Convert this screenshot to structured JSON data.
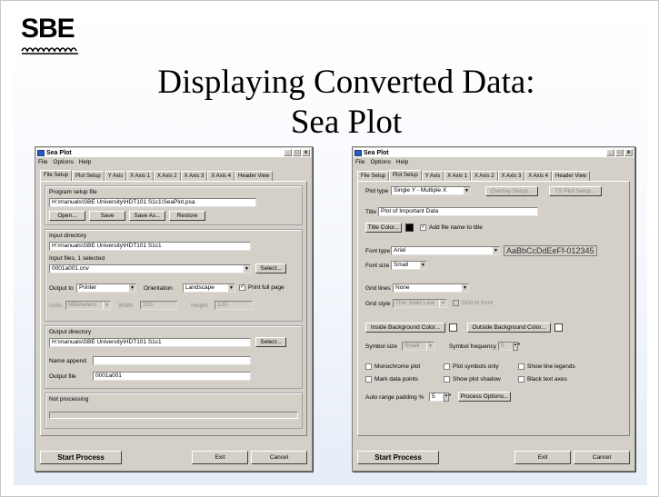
{
  "slide": {
    "logo_text": "SBE",
    "title_line1": "Displaying Converted Data:",
    "title_line2": "Sea Plot"
  },
  "colors": {
    "title_bar": "#ffffff",
    "window_face": "#d4d0c8",
    "app_icon": "#2a5bb8"
  },
  "left_window": {
    "title": "Sea Plot",
    "controls": [
      "_",
      "□",
      "x"
    ],
    "menu": [
      "File",
      "Options",
      "Help"
    ],
    "tabs": [
      "File Setup",
      "Plot Setup",
      "Y Axis",
      "X Axis 1",
      "X Axis 2",
      "X Axis 3",
      "X Axis 4",
      "Header View"
    ],
    "active_tab": "File Setup",
    "program_setup": {
      "label": "Program setup file",
      "value": "H:\\manuals\\SBE University\\HDT101 S1c1\\SeaPlot.psa",
      "open": "Open...",
      "save": "Save",
      "save_as": "Save As...",
      "restore": "Restore"
    },
    "input": {
      "dir_label": "Input directory",
      "dir_value": "H:\\manuals\\SBE University\\HDT101 S1c1",
      "files_label": "Input files, 1 selected",
      "files_value": "0001a001.cnv",
      "select": "Select..."
    },
    "output_to": {
      "label": "Output to",
      "value": "Printer",
      "orientation_label": "Orientation",
      "orientation_value": "Landscape",
      "print_full_page": "Print full page",
      "units_label": "Units",
      "units_value": "Millimeters",
      "width_label": "Width",
      "width_value": "100",
      "height_label": "Height",
      "height_value": "120"
    },
    "output": {
      "dir_label": "Output directory",
      "dir_value": "H:\\manuals\\SBE University\\HDT101 S1c1",
      "select": "Select...",
      "name_append_label": "Name append",
      "name_append_value": "",
      "file_label": "Output file",
      "file_value": "0001a001"
    },
    "status": "Not processing",
    "start": "Start Process",
    "exit": "Exit",
    "cancel": "Cancel"
  },
  "right_window": {
    "title": "Sea Plot",
    "controls": [
      "_",
      "□",
      "x"
    ],
    "menu": [
      "File",
      "Options",
      "Help"
    ],
    "tabs": [
      "File Setup",
      "Plot Setup",
      "Y Axis",
      "X Axis 1",
      "X Axis 2",
      "X Axis 3",
      "X Axis 4",
      "Header View"
    ],
    "active_tab": "Plot Setup",
    "plot_type_label": "Plot type",
    "plot_type_value": "Single Y - Multiple X",
    "overlay_setup": "Overlay Setup...",
    "ts_plot_setup": "TS Plot Setup...",
    "title_label": "Title",
    "title_value": "Plot of Important Data",
    "title_color": "Title Color...",
    "title_color_value": "#000000",
    "add_file_name": "Add file name to title",
    "font_type_label": "Font type",
    "font_type_value": "Arial",
    "font_preview": "AaBbCcDdEeFf-012345",
    "font_size_label": "Font size",
    "font_size_value": "Small",
    "grid_lines_label": "Grid lines",
    "grid_lines_value": "None",
    "grid_style_label": "Grid style",
    "grid_style_value": "Thin Solid Line",
    "grid_in_front": "Grid in front",
    "inside_bg": "Inside Background Color...",
    "outside_bg": "Outside Background Color...",
    "inside_bg_value": "#ffffff",
    "outside_bg_value": "#ffffff",
    "symbol_size_label": "Symbol size",
    "symbol_size_value": "Small",
    "symbol_freq_label": "Symbol frequency",
    "symbol_freq_value": "5",
    "checks": {
      "monochrome": "Monochrome plot",
      "symbols_only": "Plot symbols only",
      "line_legends": "Show line legends",
      "mark_points": "Mark data points",
      "plot_shadow": "Show plot shadow",
      "black_axes": "Black text axes"
    },
    "auto_range_label": "Auto range padding %",
    "auto_range_value": "5",
    "process_options": "Process Options...",
    "start": "Start Process",
    "exit": "Exit",
    "cancel": "Cancel"
  }
}
